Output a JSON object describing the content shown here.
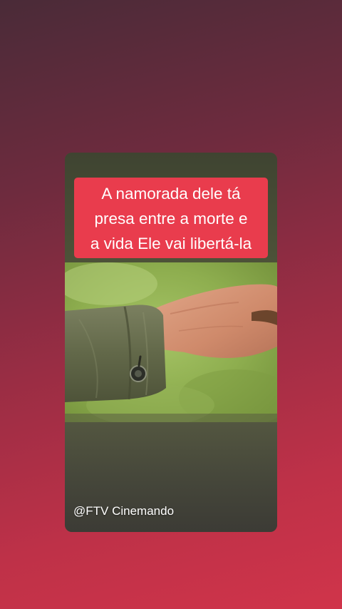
{
  "story": {
    "caption_lines": [
      "A namorada dele tá",
      "presa entre a morte e",
      "a vida Ele vai libertá-la"
    ],
    "watermark": "@FTV Cinemando",
    "video_content": "hand-with-sleeve"
  },
  "colors": {
    "background_top": "#4a2b38",
    "background_bottom": "#d0344a",
    "caption_background": "#e93c4d",
    "caption_text": "#ffffff"
  }
}
